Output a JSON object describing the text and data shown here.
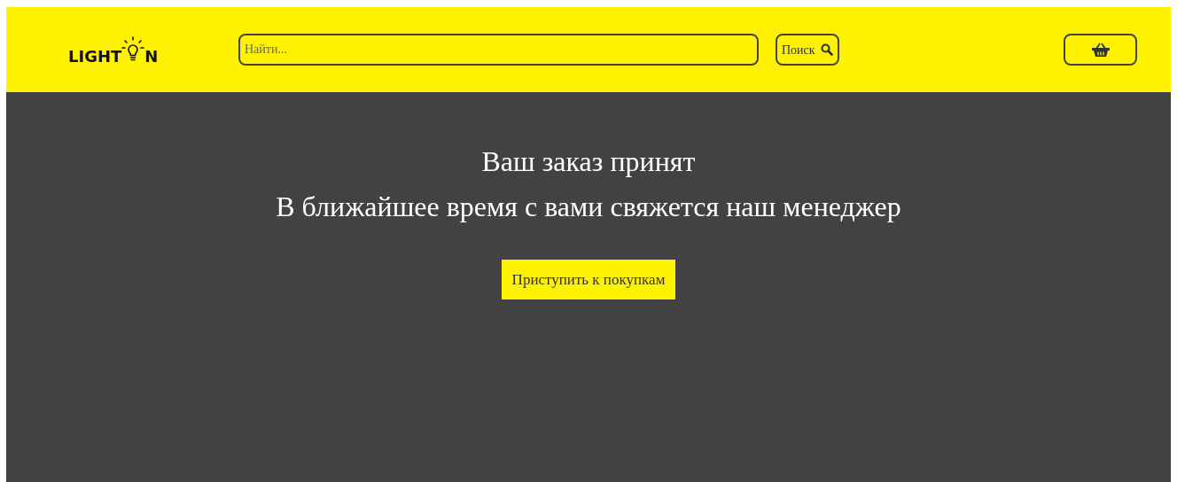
{
  "header": {
    "logo": {
      "before": "LIGHT",
      "after": "N"
    },
    "search": {
      "placeholder": "Найти..."
    },
    "search_button": "Поиск"
  },
  "message": {
    "title": "Ваш заказ принят",
    "subtitle": "В ближайшее время с вами свяжется наш менеджер",
    "button": "Приступить к покупкам"
  }
}
